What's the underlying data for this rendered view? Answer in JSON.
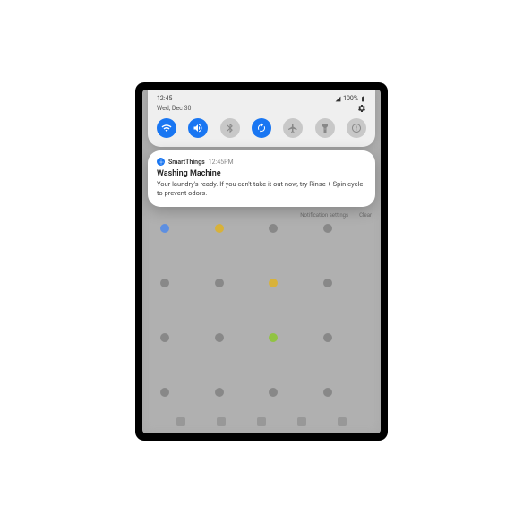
{
  "statusbar": {
    "time": "12:45",
    "signal_label": "signal",
    "battery_text": "100%"
  },
  "shade": {
    "date": "Wed, Dec 30",
    "quick_settings": [
      {
        "name": "wifi-icon",
        "active": true
      },
      {
        "name": "volume-icon",
        "active": true
      },
      {
        "name": "bluetooth-icon",
        "active": false
      },
      {
        "name": "rotate-icon",
        "active": true
      },
      {
        "name": "airplane-icon",
        "active": false
      },
      {
        "name": "flashlight-icon",
        "active": false
      },
      {
        "name": "power-saving-icon",
        "active": false
      }
    ]
  },
  "notification": {
    "app_name": "SmartThings",
    "time": "12:45PM",
    "title": "Washing Machine",
    "body": "Your laundry's ready. If you can't take it out now, try Rinse + Spin cycle to prevent odors."
  },
  "footer": {
    "settings": "Notification settings",
    "clear": "Clear"
  }
}
